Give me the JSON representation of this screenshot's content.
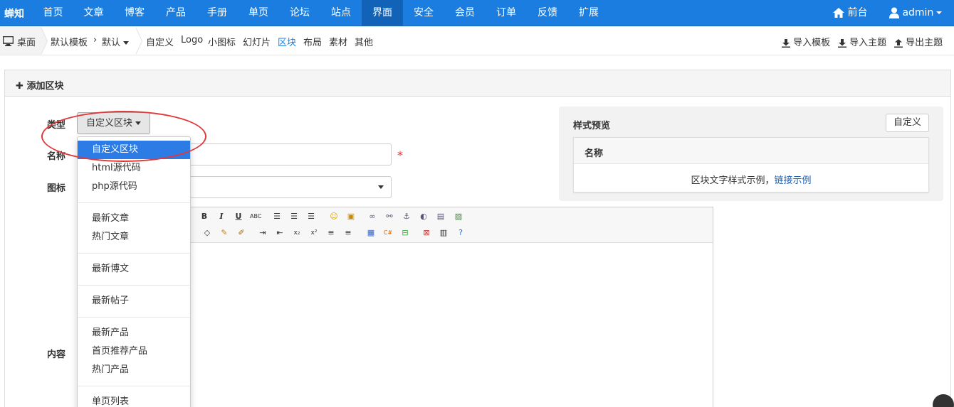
{
  "nav": {
    "brand": "蝉知",
    "items": [
      "首页",
      "文章",
      "博客",
      "产品",
      "手册",
      "单页",
      "论坛",
      "站点",
      "界面",
      "安全",
      "会员",
      "订单",
      "反馈",
      "扩展"
    ],
    "active_index": 8,
    "front": "前台",
    "user": "admin"
  },
  "crumbs": {
    "home": "桌面",
    "template": "默认模板",
    "theme": "默认",
    "links": [
      "自定义",
      "Logo",
      "小图标",
      "幻灯片",
      "区块",
      "布局",
      "素材",
      "其他"
    ],
    "active_link": "区块",
    "import_template": "导入模板",
    "import_theme": "导入主题",
    "export_theme": "导出主题"
  },
  "panel": {
    "title": "添加区块"
  },
  "form": {
    "type_label": "类型",
    "type_value": "自定义区块",
    "name_label": "名称",
    "icon_label": "图标",
    "content_label": "内容",
    "required_mark": "*"
  },
  "dropdown": {
    "items": [
      "自定义区块",
      "html源代码",
      "php源代码",
      "最新文章",
      "热门文章",
      "最新博文",
      "最新帖子",
      "最新产品",
      "首页推荐产品",
      "热门产品",
      "单页列表"
    ]
  },
  "preview": {
    "title": "样式预览",
    "custom_button": "自定义",
    "box_title": "名称",
    "sample_text": "区块文字样式示例，",
    "sample_link": "链接示例"
  }
}
